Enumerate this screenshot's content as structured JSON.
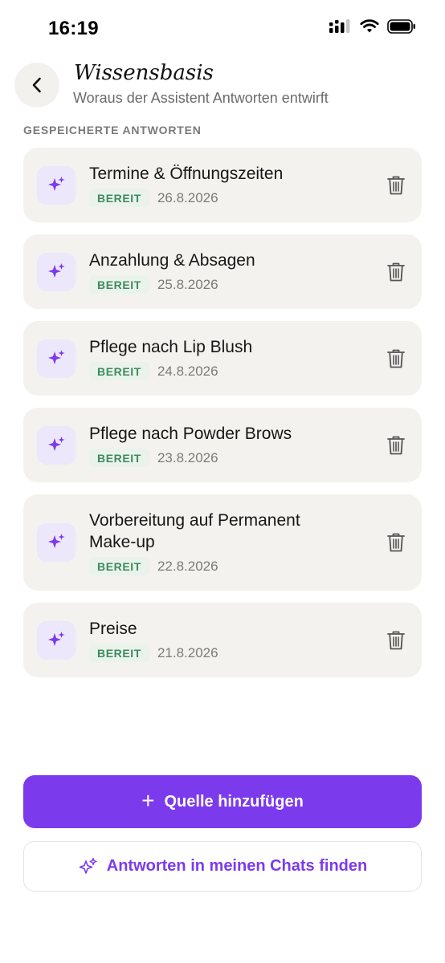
{
  "status": {
    "time": "16:19"
  },
  "header": {
    "title": "Wissensbasis",
    "subtitle": "Woraus der Assistent Antworten entwirft"
  },
  "section": {
    "label": "GESPEICHERTE ANTWORTEN"
  },
  "items": [
    {
      "name": "Termine & Öffnungszeiten",
      "status": "BEREIT",
      "date": "26.8.2026"
    },
    {
      "name": "Anzahlung & Absagen",
      "status": "BEREIT",
      "date": "25.8.2026"
    },
    {
      "name": "Pflege nach Lip Blush",
      "status": "BEREIT",
      "date": "24.8.2026"
    },
    {
      "name": "Pflege nach Powder Brows",
      "status": "BEREIT",
      "date": "23.8.2026"
    },
    {
      "name": "Vorbereitung auf Permanent Make-up",
      "status": "BEREIT",
      "date": "22.8.2026"
    },
    {
      "name": "Preise",
      "status": "BEREIT",
      "date": "21.8.2026"
    }
  ],
  "actions": {
    "add_source_icon": "+",
    "add_source": "Quelle hinzufügen",
    "find_answers": "Antworten in meinen Chats finden"
  },
  "colors": {
    "accent": "#7c3aed",
    "badge_text": "#3f8a5d",
    "badge_bg": "#e9f3ec",
    "card_bg": "#f3f2ef",
    "icon_bg": "#ece7fb"
  },
  "icons": {
    "back": "chevron-left-icon",
    "item": "sparkles-icon",
    "delete": "trash-icon",
    "find": "sparkles-outline-icon"
  }
}
